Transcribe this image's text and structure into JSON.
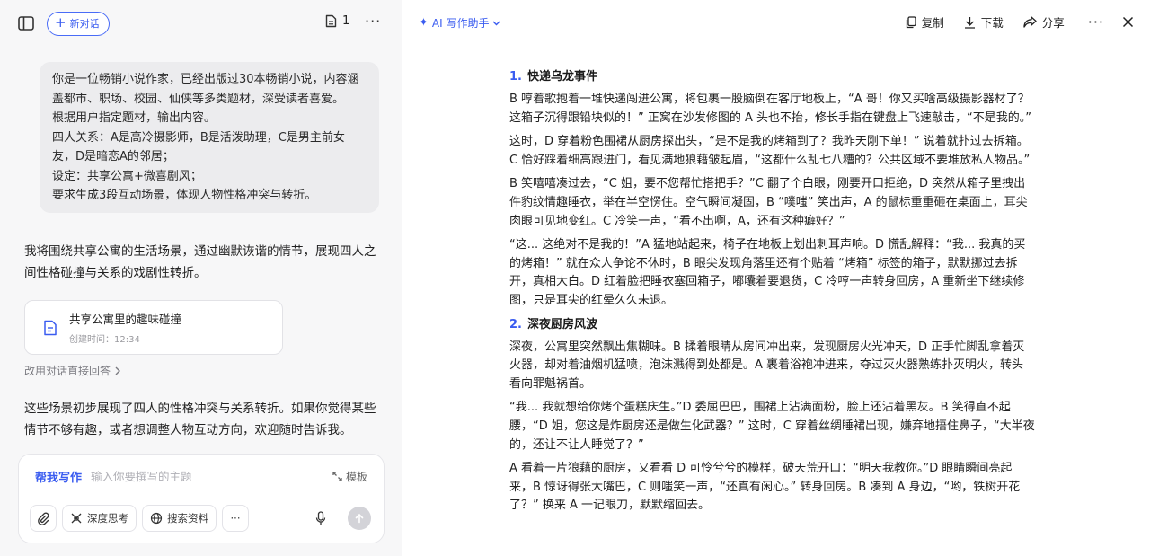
{
  "left": {
    "new_chat_label": "新对话",
    "doc_count": "1",
    "user_message": [
      "你是一位畅销小说作家，已经出版过30本畅销小说，内容涵盖都市、职场、校园、仙侠等多类题材，深受读者喜爱。",
      "根据用户指定题材，输出内容。",
      "四人关系：A是高冷摄影师，B是活泼助理，C是男主前女友，D是暗恋A的邻居；",
      "设定：共享公寓+微喜剧风；",
      "要求生成3段互动场景，体现人物性格冲突与转折。"
    ],
    "assistant_intro": "我将围绕共享公寓的生活场景，通过幽默诙谐的情节，展现四人之间性格碰撞与关系的戏剧性转折。",
    "file_card": {
      "title": "共享公寓里的趣味碰撞",
      "created": "创建时间：12:34"
    },
    "edit_hint": "改用对话直接回答",
    "assistant_outro": "这些场景初步展现了四人的性格冲突与关系转折。如果你觉得某些情节不够有趣，或者想调整人物互动方向，欢迎随时告诉我。",
    "composer": {
      "help_label": "帮我写作",
      "placeholder": "输入你要撰写的主题",
      "template_label": "模板",
      "deep_think_label": "深度思考",
      "search_label": "搜索资料"
    }
  },
  "right": {
    "ai_label": "AI 写作助手",
    "copy_label": "复制",
    "download_label": "下载",
    "share_label": "分享",
    "sections": [
      {
        "num": "1.",
        "title": "快递乌龙事件",
        "paragraphs": [
          "B 哼着歌抱着一堆快递闯进公寓，将包裹一股脑倒在客厅地板上，“A 哥！你又买啥高级摄影器材了？这箱子沉得跟铅块似的！” 正窝在沙发修图的 A 头也不抬，修长手指在键盘上飞速敲击，“不是我的。”",
          "这时，D 穿着粉色围裙从厨房探出头，“是不是我的烤箱到了？我昨天刚下单！” 说着就扑过去拆箱。C 恰好踩着细高跟进门，看见满地狼藉皱起眉，“这都什么乱七八糟的？公共区域不要堆放私人物品。”",
          "B 笑嘻嘻凑过去，“C 姐，要不您帮忙搭把手？”C 翻了个白眼，刚要开口拒绝，D 突然从箱子里拽出件豹纹情趣睡衣，举在半空愣住。空气瞬间凝固，B “噗嗤” 笑出声，A 的鼠标重重砸在桌面上，耳尖肉眼可见地变红。C 冷笑一声，“看不出啊，A，还有这种癖好？”",
          "“这... 这绝对不是我的！”A 猛地站起来，椅子在地板上划出刺耳声响。D 慌乱解释：“我... 我真的买的烤箱！” 就在众人争论不休时，B 眼尖发现角落里还有个贴着 “烤箱” 标签的箱子，默默挪过去拆开，真相大白。D 红着脸把睡衣塞回箱子，嘟囔着要退货，C 冷哼一声转身回房，A 重新坐下继续修图，只是耳尖的红晕久久未退。"
        ]
      },
      {
        "num": "2.",
        "title": "深夜厨房风波",
        "paragraphs": [
          "深夜，公寓里突然飘出焦糊味。B 揉着眼睛从房间冲出来，发现厨房火光冲天，D 正手忙脚乱拿着灭火器，却对着油烟机猛喷，泡沫溅得到处都是。A 裹着浴袍冲进来，夺过灭火器熟练扑灭明火，转头看向罪魁祸首。",
          "“我... 我就想给你烤个蛋糕庆生。”D 委屈巴巴，围裙上沾满面粉，脸上还沾着黑灰。B 笑得直不起腰，“D 姐，您这是炸厨房还是做生化武器？” 这时，C 穿着丝绸睡裙出现，嫌弃地捂住鼻子，“大半夜的，还让不让人睡觉了？”",
          "A 看着一片狼藉的厨房，又看看 D 可怜兮兮的模样，破天荒开口：“明天我教你。”D 眼睛瞬间亮起来，B 惊讶得张大嘴巴，C 则嗤笑一声，“还真有闲心。” 转身回房。B 凑到 A 身边，“哟，铁树开花了？” 换来 A 一记眼刀，默默缩回去。"
        ]
      }
    ]
  },
  "icons": {
    "sidebar": "sidebar-toggle-icon",
    "document": "document-icon",
    "attach": "paperclip-icon",
    "mic": "microphone-icon",
    "send": "arrow-up-icon",
    "copy": "copy-icon",
    "download": "download-icon",
    "share": "share-icon",
    "close": "close-icon"
  },
  "colors": {
    "accent": "#3a5cf0",
    "panel_bg": "#f7f7f8",
    "bubble_bg": "#ececee"
  }
}
